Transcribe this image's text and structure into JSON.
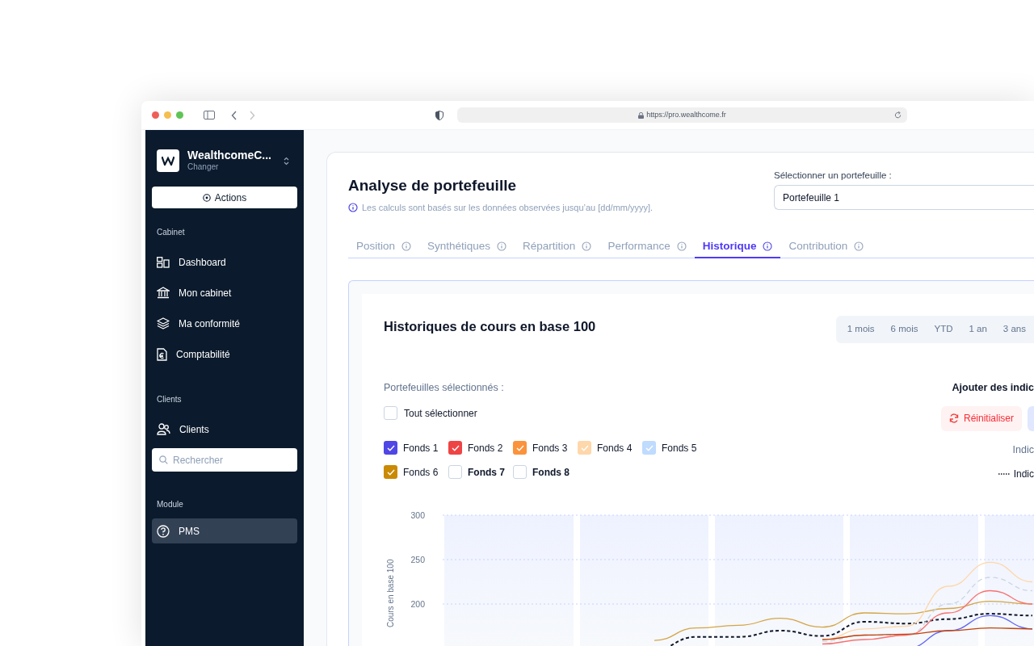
{
  "browser": {
    "url": "https://pro.wealthcome.fr"
  },
  "sidebar": {
    "org_name": "WealthcomeC...",
    "org_action": "Changer",
    "actions_button": "Actions",
    "sections": [
      {
        "title": "Cabinet",
        "items": [
          {
            "label": "Dashboard",
            "kind": "dashboard",
            "selected": false
          },
          {
            "label": "Mon cabinet",
            "kind": "bank",
            "selected": false
          },
          {
            "label": "Ma conformité",
            "kind": "layers",
            "selected": false
          },
          {
            "label": "Comptabilité",
            "kind": "document",
            "selected": false
          }
        ]
      },
      {
        "title": "Clients",
        "items": [
          {
            "label": "Clients",
            "kind": "users",
            "selected": false
          }
        ],
        "search": {
          "placeholder": "Rechercher"
        }
      },
      {
        "title": "Module",
        "items": [
          {
            "label": "PMS",
            "kind": "help",
            "selected": true
          }
        ]
      }
    ]
  },
  "header": {
    "title": "Analyse de portefeuille",
    "note": "Les calculs sont basés sur les données observées jusqu’au [dd/mm/yyyy].",
    "select_label": "Sélectionner un portefeuille :",
    "select_value": "Portefeuille 1"
  },
  "tabs": [
    {
      "label": "Position",
      "selected": false
    },
    {
      "label": "Synthétiques",
      "selected": false
    },
    {
      "label": "Répartition",
      "selected": false
    },
    {
      "label": "Performance",
      "selected": false
    },
    {
      "label": "Historique",
      "selected": true
    },
    {
      "label": "Contribution",
      "selected": false
    }
  ],
  "chart_panel": {
    "title": "Historiques de cours en base 100",
    "periods": [
      {
        "label": "1 mois",
        "selected": false
      },
      {
        "label": "6 mois",
        "selected": false
      },
      {
        "label": "YTD",
        "selected": false
      },
      {
        "label": "1 an",
        "selected": false
      },
      {
        "label": "3 ans",
        "selected": false
      }
    ],
    "selected_label": "Portefeuilles sélectionnés :",
    "select_all": {
      "label": "Tout sélectionner",
      "checked": false
    },
    "funds": [
      {
        "label": "Fonds 1",
        "checked": true,
        "color": "#4f46e5"
      },
      {
        "label": "Fonds 2",
        "checked": true,
        "color": "#ef4444"
      },
      {
        "label": "Fonds 3",
        "checked": true,
        "color": "#fb923c"
      },
      {
        "label": "Fonds 4",
        "checked": true,
        "color": "#fed7aa"
      },
      {
        "label": "Fonds 5",
        "checked": true,
        "color": "#bfdbfe"
      },
      {
        "label": "Fonds 6",
        "checked": true,
        "color": "#ca8a04"
      },
      {
        "label": "Fonds 7",
        "checked": false
      },
      {
        "label": "Fonds 8",
        "checked": false
      }
    ],
    "indicators_title": "Ajouter des indic",
    "reset_button": "Réinitialiser",
    "indicators_label": "Indic",
    "indicator_legend": "Indic",
    "chart": {
      "y_axis_title": "Cours en base 100",
      "y_ticks": [
        "300",
        "250",
        "200"
      ]
    }
  }
}
